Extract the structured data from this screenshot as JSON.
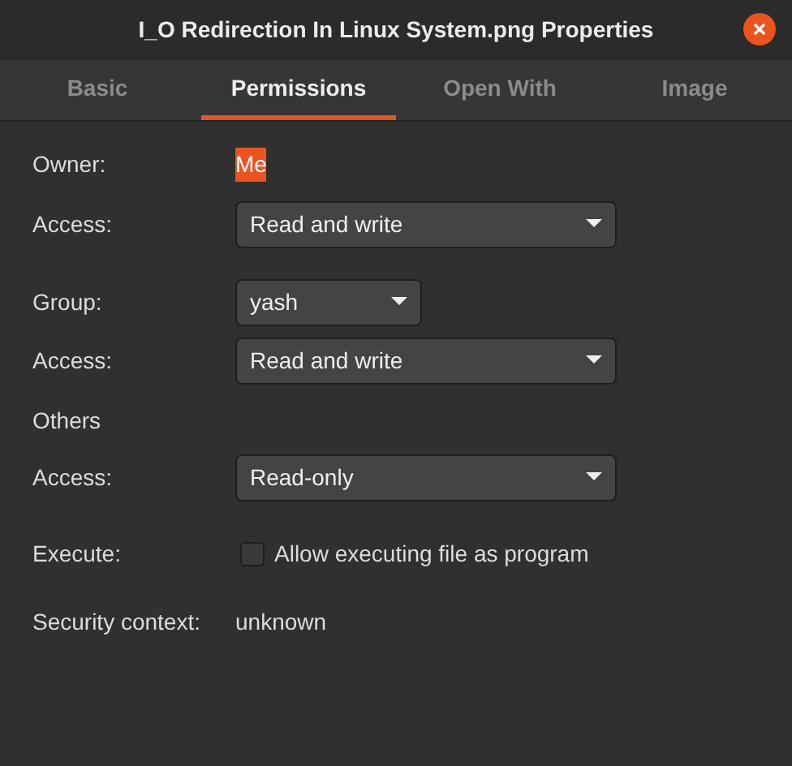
{
  "window": {
    "title": "I_O Redirection In Linux System.png Properties"
  },
  "tabs": [
    {
      "label": "Basic",
      "selected": false
    },
    {
      "label": "Permissions",
      "selected": true
    },
    {
      "label": "Open With",
      "selected": false
    },
    {
      "label": "Image",
      "selected": false
    }
  ],
  "rows": [
    {
      "kind": "text",
      "label": "Owner:",
      "value": "Me",
      "highlighted": true
    },
    {
      "kind": "dropdown",
      "label": "Access:",
      "value": "Read and write",
      "wide": true
    },
    {
      "kind": "gap"
    },
    {
      "kind": "dropdown",
      "label": "Group:",
      "value": "yash",
      "wide": false
    },
    {
      "kind": "dropdown",
      "label": "Access:",
      "value": "Read and write",
      "wide": true
    },
    {
      "kind": "heading",
      "label": "Others"
    },
    {
      "kind": "dropdown",
      "label": "Access:",
      "value": "Read-only",
      "wide": true
    },
    {
      "kind": "checkbox",
      "label": "Execute:",
      "value": "Allow executing file as program",
      "checked": false
    },
    {
      "kind": "text",
      "label": "Security context:",
      "value": "unknown",
      "highlighted": false
    }
  ]
}
